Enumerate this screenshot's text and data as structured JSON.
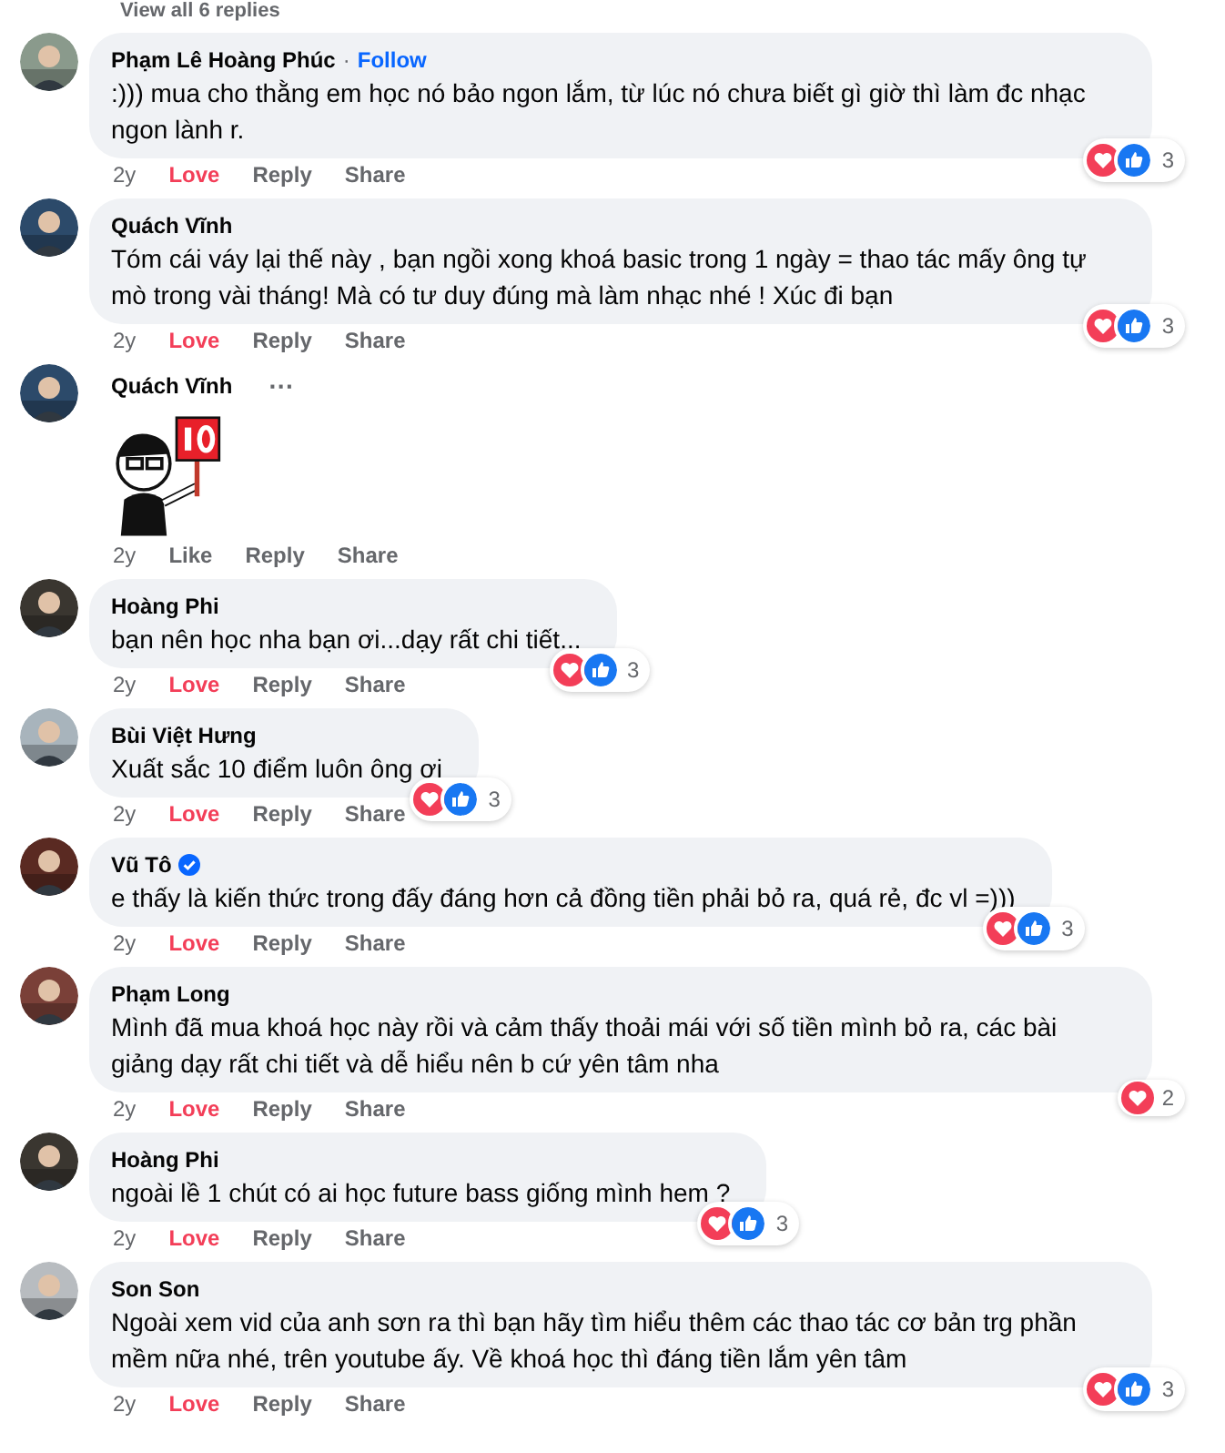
{
  "view_replies": {
    "label": "View all 6 replies"
  },
  "comments": [
    {
      "kind": "text",
      "author": "Phạm Lê Hoàng Phúc",
      "separator": "·",
      "follow": "Follow",
      "verified": false,
      "text": ":))) mua cho thằng em học nó bảo ngon lắm, từ lúc nó chưa biết gì giờ thì làm đc nhạc ngon lành r.",
      "time": "2y",
      "reaction_label": "Love",
      "reacted": true,
      "actions": [
        "Reply",
        "Share"
      ],
      "reactions": {
        "love": true,
        "like": true
      },
      "count": "3"
    },
    {
      "kind": "text",
      "author": "Quách Vĩnh",
      "verified": false,
      "text": "Tóm cái váy lại thế này , bạn ngồi xong khoá basic trong 1 ngày = thao tác mấy ông tự mò trong vài tháng! Mà có tư duy đúng mà làm nhạc nhé ! Xúc đi bạn",
      "time": "2y",
      "reaction_label": "Love",
      "reacted": true,
      "actions": [
        "Reply",
        "Share"
      ],
      "reactions": {
        "love": true,
        "like": true
      },
      "count": "3"
    },
    {
      "kind": "sticker",
      "author": "Quách Vĩnh",
      "verified": false,
      "more": "···",
      "time": "2y",
      "reaction_label": "Like",
      "reacted": false,
      "actions": [
        "Reply",
        "Share"
      ]
    },
    {
      "kind": "text",
      "author": "Hoàng Phi",
      "verified": false,
      "text": "bạn nên học nha bạn ơi...dạy rất chi tiết...",
      "time": "2y",
      "reaction_label": "Love",
      "reacted": true,
      "actions": [
        "Reply",
        "Share"
      ],
      "reactions": {
        "love": true,
        "like": true
      },
      "count": "3"
    },
    {
      "kind": "text",
      "author": "Bùi Việt Hưng",
      "verified": false,
      "text": "Xuất sắc 10 điểm luôn ông ơi",
      "time": "2y",
      "reaction_label": "Love",
      "reacted": true,
      "actions": [
        "Reply",
        "Share"
      ],
      "reactions": {
        "love": true,
        "like": true
      },
      "count": "3"
    },
    {
      "kind": "text",
      "author": "Vũ Tô",
      "verified": true,
      "text": "e thấy là kiến thức trong đấy đáng hơn cả đồng tiền phải bỏ ra, quá rẻ, đc vl =)))",
      "time": "2y",
      "reaction_label": "Love",
      "reacted": true,
      "actions": [
        "Reply",
        "Share"
      ],
      "reactions": {
        "love": true,
        "like": true
      },
      "count": "3"
    },
    {
      "kind": "text",
      "author": "Phạm Long",
      "verified": false,
      "text": "Mình đã mua khoá học này rồi và cảm thấy thoải mái với số tiền mình bỏ ra, các bài giảng dạy rất chi tiết và dễ hiểu nên b cứ yên tâm nha",
      "time": "2y",
      "reaction_label": "Love",
      "reacted": true,
      "actions": [
        "Reply",
        "Share"
      ],
      "reactions": {
        "love": true,
        "like": false
      },
      "count": "2"
    },
    {
      "kind": "text",
      "author": "Hoàng Phi",
      "verified": false,
      "text": "ngoài lề 1 chút có ai học future bass giống mình hem ?",
      "time": "2y",
      "reaction_label": "Love",
      "reacted": true,
      "actions": [
        "Reply",
        "Share"
      ],
      "reactions": {
        "love": true,
        "like": true
      },
      "count": "3"
    },
    {
      "kind": "text",
      "author": "Son Son",
      "verified": false,
      "text": "Ngoài xem vid của anh sơn ra thì bạn hãy tìm hiểu thêm các thao tác cơ bản trg phần mềm nữa nhé, trên youtube ấy. Về khoá học thì đáng tiền lắm yên tâm",
      "time": "2y",
      "reaction_label": "Love",
      "reacted": true,
      "actions": [
        "Reply",
        "Share"
      ],
      "reactions": {
        "love": true,
        "like": true
      },
      "count": "3"
    }
  ]
}
